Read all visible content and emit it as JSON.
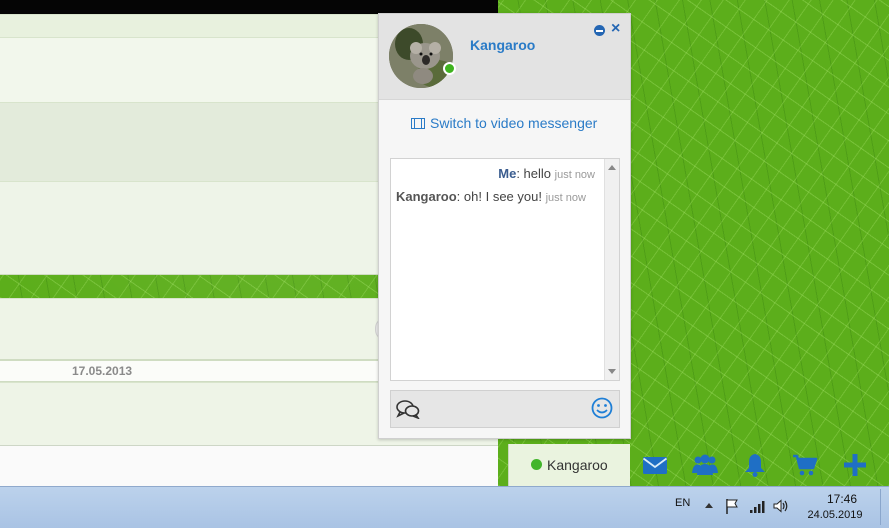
{
  "chat": {
    "contact_name": "Kangaroo",
    "status": "online",
    "video_link_label": "Switch to video messenger",
    "messages": [
      {
        "sender": "Me",
        "text": "hello",
        "time": "just now"
      },
      {
        "sender": "Kangaroo",
        "text": "oh! I see you!",
        "time": "just now"
      }
    ],
    "input_placeholder": ""
  },
  "background_page": {
    "date_label": "17.05.2013"
  },
  "contact_tab": {
    "name": "Kangaroo"
  },
  "toolbar": {
    "icons": [
      "envelope-icon",
      "users-icon",
      "bell-icon",
      "cart-icon",
      "plus-icon"
    ]
  },
  "taskbar": {
    "language": "EN",
    "time": "17:46",
    "date": "24.05.2019"
  },
  "colors": {
    "accent": "#2a7bc7",
    "online": "#42b52b",
    "toolbar_icon": "#1f6fc5",
    "background_leaf": "#5cae1b"
  }
}
